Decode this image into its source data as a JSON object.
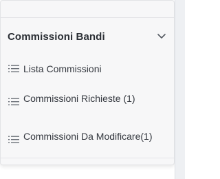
{
  "sidebar": {
    "section_title": "Commissioni Bandi",
    "items": [
      {
        "label": "Lista Commissioni",
        "icon": "list-icon"
      },
      {
        "label": "Commissioni Richieste (1)",
        "icon": "list-icon"
      },
      {
        "label": "Commissioni Da Modificare(1)",
        "icon": "list-icon"
      }
    ]
  },
  "colors": {
    "panel_background": "#f7f7f8",
    "text": "#34383f",
    "title": "#2b2f35",
    "icon": "#6b7078"
  }
}
